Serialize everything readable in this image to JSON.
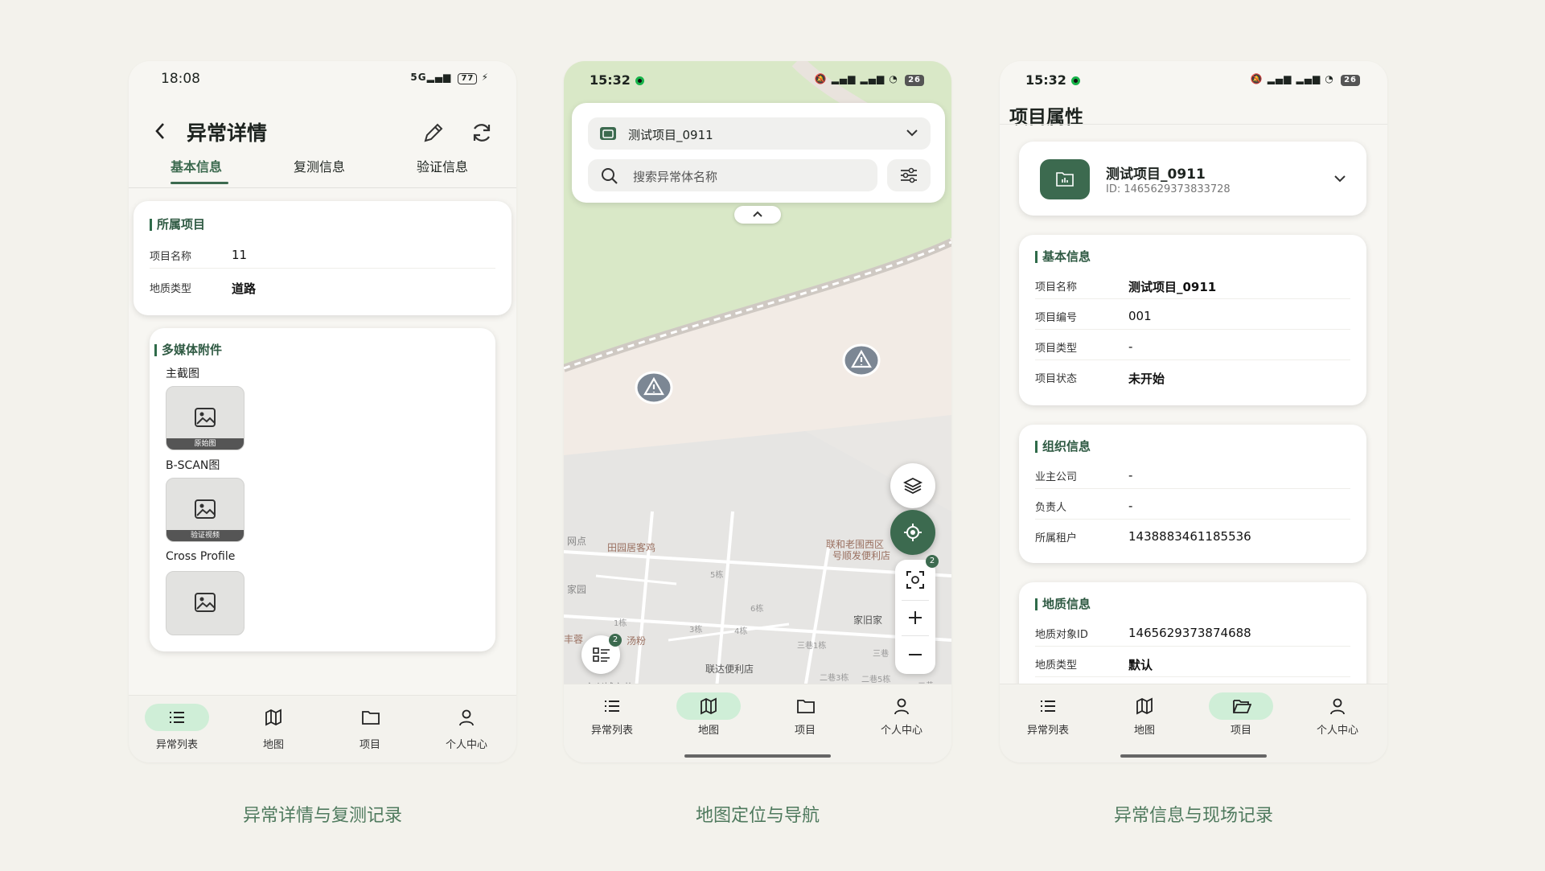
{
  "accent": "#3c6a4f",
  "screens": [
    {
      "time": "18:08",
      "signal": "5G",
      "battery": "77",
      "title": "异常详情",
      "tabs": [
        "基本信息",
        "复测信息",
        "验证信息"
      ],
      "project_section": "所属项目",
      "project_rows": [
        {
          "key": "项目名称",
          "value": "11"
        },
        {
          "key": "地质类型",
          "value": "道路"
        }
      ],
      "media_section": "多媒体附件",
      "media": [
        {
          "label": "主截图",
          "badge": "原始图"
        },
        {
          "label": "B-SCAN图",
          "badge": "验证视频"
        },
        {
          "label": "Cross Profile",
          "badge": ""
        }
      ],
      "nav": [
        "异常列表",
        "地图",
        "项目",
        "个人中心"
      ],
      "active_nav": 0,
      "caption": "异常详情与复测记录"
    },
    {
      "time": "15:32",
      "battery": "26",
      "project_select": "测试项目_0911",
      "search_placeholder": "搜索异常体名称",
      "map_labels": [
        "田园居客鸡",
        "联和老围西区",
        "号顺发便利店",
        "家旧家",
        "联达便利店",
        "网点",
        "家园",
        "5栋",
        "6栋",
        "1栋",
        "3栋",
        "4栋",
        "三巷1栋",
        "二巷3栋",
        "二巷5栋",
        "三巷",
        "二巷",
        "丰蓉",
        "汤粉",
        "文兴城市花"
      ],
      "scan_badge": "2",
      "list_badge": "2",
      "nav": [
        "异常列表",
        "地图",
        "项目",
        "个人中心"
      ],
      "active_nav": 1,
      "caption": "地图定位与导航"
    },
    {
      "time": "15:32",
      "battery": "26",
      "title": "项目属性",
      "project_name": "测试项目_0911",
      "project_id": "ID: 1465629373833728",
      "basic_section": "基本信息",
      "basic_rows": [
        {
          "key": "项目名称",
          "value": "测试项目_0911"
        },
        {
          "key": "项目编号",
          "value": "001"
        },
        {
          "key": "项目类型",
          "value": "-"
        },
        {
          "key": "项目状态",
          "value": "未开始"
        }
      ],
      "org_section": "组织信息",
      "org_rows": [
        {
          "key": "业主公司",
          "value": "-"
        },
        {
          "key": "负责人",
          "value": "-"
        },
        {
          "key": "所属租户",
          "value": "1438883461185536"
        }
      ],
      "geo_section": "地质信息",
      "geo_rows": [
        {
          "key": "地质对象ID",
          "value": "1465629373874688"
        },
        {
          "key": "地质类型",
          "value": "默认"
        }
      ],
      "nav": [
        "异常列表",
        "地图",
        "项目",
        "个人中心"
      ],
      "active_nav": 2,
      "caption": "异常信息与现场记录"
    }
  ]
}
